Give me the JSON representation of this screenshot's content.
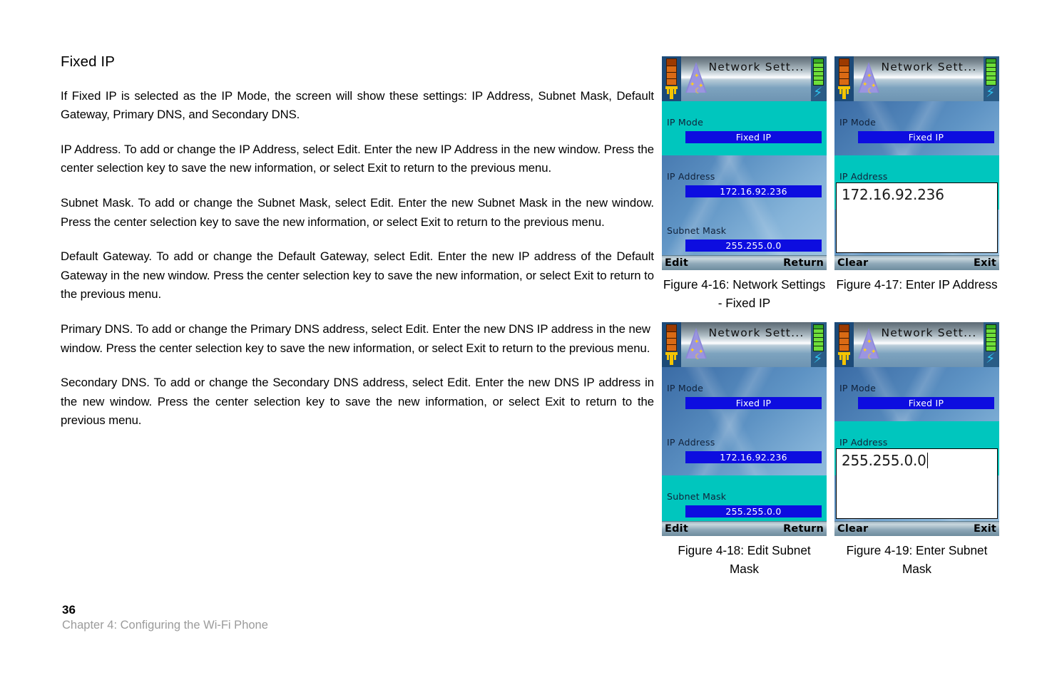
{
  "section": {
    "title": "Fixed IP",
    "paragraphs": [
      "If Fixed IP is selected as the IP Mode, the screen will show these settings: IP Address, Subnet Mask, Default Gateway, Primary DNS, and Secondary DNS.",
      "IP Address. To add or change the IP Address, select Edit. Enter the new IP Address in the new window. Press the center selection key to save the new information, or select Exit to return to the previous menu.",
      "Subnet Mask. To add or change the Subnet Mask, select Edit. Enter the new Subnet Mask in the new window. Press the center selection key to save the new information, or select Exit to return to the previous menu.",
      "Default Gateway. To add or change the Default Gateway, select Edit. Enter the new IP address of the Default Gateway in the new window. Press the center selection key to save the new information, or select Exit to return to the previous menu.",
      "Primary DNS. To add or change the Primary DNS address, select Edit. Enter the new DNS IP address in the new window. Press the center selection key to save the new information, or select Exit to return to the previous menu.",
      "Secondary DNS. To add or change the Secondary DNS address, select Edit. Enter the new DNS IP address in the new window. Press the center selection key to save the new information, or select Exit to return to the previous menu."
    ]
  },
  "footer": {
    "page_number": "36",
    "chapter": "Chapter 4: Configuring the Wi-Fi Phone"
  },
  "colors": {
    "selection_teal": "#00c6be",
    "value_blue": "#0d0de0",
    "screen_blue": "#5e93c4",
    "chapter_gray": "#9b9b9b"
  },
  "figures": [
    {
      "id": "fig-4-16",
      "caption": "Figure 4-16: Network Settings - Fixed IP",
      "screen": {
        "title": "Network Sett...",
        "icons": {
          "signal": "signal-strength-icon",
          "app": "network-cone-icon",
          "battery": "battery-charging-icon"
        },
        "rows": [
          {
            "label": "IP Mode",
            "value": "Fixed IP",
            "selected": true
          },
          {
            "label": "IP Address",
            "value": "172.16.92.236",
            "selected": false
          },
          {
            "label": "Subnet Mask",
            "value": "255.255.0.0",
            "selected": false
          }
        ],
        "softkeys": {
          "left": "Edit",
          "right": "Return"
        },
        "entry": null
      }
    },
    {
      "id": "fig-4-17",
      "caption": "Figure 4-17: Enter IP Address",
      "screen": {
        "title": "Network Sett...",
        "icons": {
          "signal": "signal-strength-icon",
          "app": "network-cone-icon",
          "battery": "battery-charging-icon"
        },
        "rows": [
          {
            "label": "IP Mode",
            "value": "Fixed IP",
            "selected": false
          },
          {
            "label": "IP Address",
            "value": "",
            "selected": true
          }
        ],
        "softkeys": {
          "left": "Clear",
          "right": "Exit"
        },
        "entry": {
          "text": "172.16.92.236",
          "caret": false
        }
      }
    },
    {
      "id": "fig-4-18",
      "caption": "Figure 4-18: Edit Subnet Mask",
      "screen": {
        "title": "Network Sett...",
        "icons": {
          "signal": "signal-strength-icon",
          "app": "network-cone-icon",
          "battery": "battery-charging-icon"
        },
        "rows": [
          {
            "label": "IP Mode",
            "value": "Fixed IP",
            "selected": false
          },
          {
            "label": "IP Address",
            "value": "172.16.92.236",
            "selected": false
          },
          {
            "label": "Subnet Mask",
            "value": "255.255.0.0",
            "selected": true
          }
        ],
        "softkeys": {
          "left": "Edit",
          "right": "Return"
        },
        "entry": null
      }
    },
    {
      "id": "fig-4-19",
      "caption": "Figure 4-19: Enter Subnet Mask",
      "screen": {
        "title": "Network Sett...",
        "icons": {
          "signal": "signal-strength-icon",
          "app": "network-cone-icon",
          "battery": "battery-charging-icon"
        },
        "rows": [
          {
            "label": "IP Mode",
            "value": "Fixed IP",
            "selected": false
          },
          {
            "label": "IP Address",
            "value": "",
            "selected": true
          }
        ],
        "softkeys": {
          "left": "Clear",
          "right": "Exit"
        },
        "entry": {
          "text": "255.255.0.0",
          "caret": true
        }
      }
    }
  ]
}
